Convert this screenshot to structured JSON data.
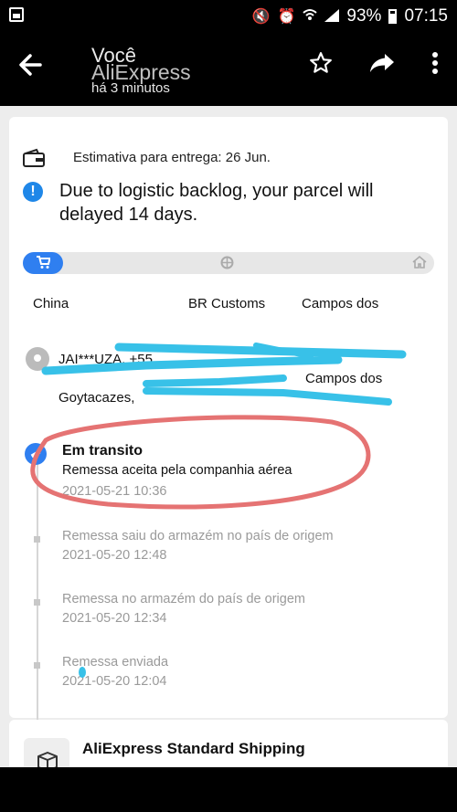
{
  "status_bar": {
    "battery": "93%",
    "time": "07:15",
    "icons": [
      "gallery-icon",
      "mute-icon",
      "alarm-icon",
      "wifi-icon",
      "signal-icon",
      "battery-icon"
    ]
  },
  "header": {
    "sender": "Você",
    "app": "AliExpress",
    "time_ago": "há 3 minutos",
    "icons": [
      "back-arrow-icon",
      "star-icon",
      "share-icon",
      "more-icon"
    ]
  },
  "delivery": {
    "estimate": "Estimativa para entrega: 26 Jun.",
    "alert": "Due to logistic backlog, your parcel will delayed 14 days."
  },
  "route": {
    "stages": [
      "China",
      "BR Customs",
      "Campos dos Goytacazes"
    ],
    "icons": [
      "cart-icon",
      "customs-icon",
      "home-icon"
    ]
  },
  "address": {
    "line1": "JAI***UZA,  +55",
    "line2": "Campos dos",
    "line3": "Goytacazes,"
  },
  "timeline": {
    "current": {
      "status": "Em transito",
      "description": "Remessa aceita pela companhia aérea",
      "date": "2021-05-21 10:36"
    },
    "events": [
      {
        "description": "Remessa saiu do armazém no país de origem",
        "date": "2021-05-20 12:48"
      },
      {
        "description": "Remessa no armazém do país de origem",
        "date": "2021-05-20 12:34"
      },
      {
        "description": "Remessa enviada",
        "date": "2021-05-20 12:04"
      }
    ]
  },
  "shipping": {
    "carrier": "AliExpress Standard Shipping"
  },
  "colors": {
    "accent": "#2f7ff0",
    "alert": "#1f87e8",
    "annotation": "#e57373",
    "redaction": "#38c1e8"
  }
}
